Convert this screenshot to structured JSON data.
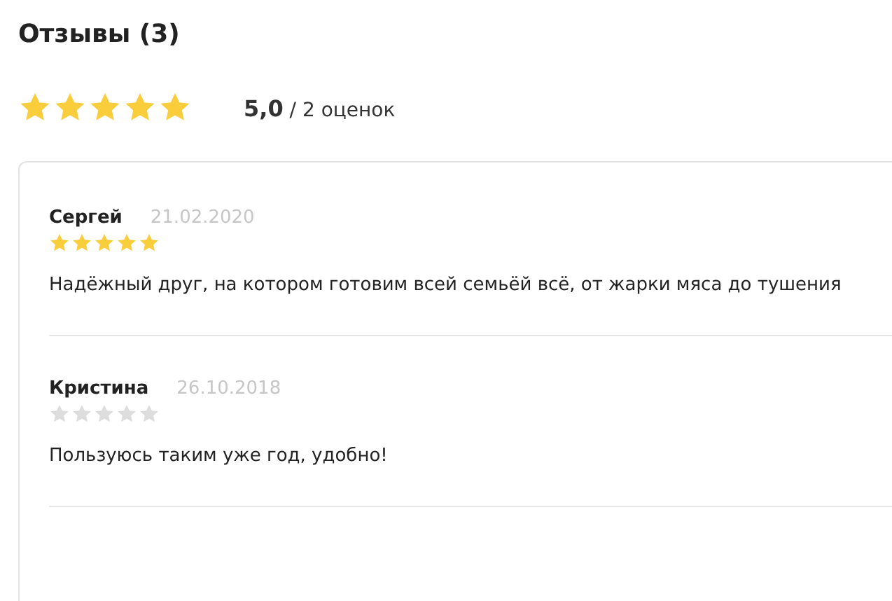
{
  "title": "Отзывы (3)",
  "summary": {
    "stars": 5,
    "rating": "**5,0** / 2 оценок"
  },
  "reviews": [
    {
      "author": "Сергей",
      "date": "21.02.2020",
      "stars": 5,
      "text": "Надёжный друг, на котором готовим всей семьёй всё, от жарки мяса до тушения"
    },
    {
      "author": "Кристина",
      "date": "26.10.2018",
      "stars": 0,
      "text": "Пользуюсь таким уже год, удобно!"
    }
  ]
}
